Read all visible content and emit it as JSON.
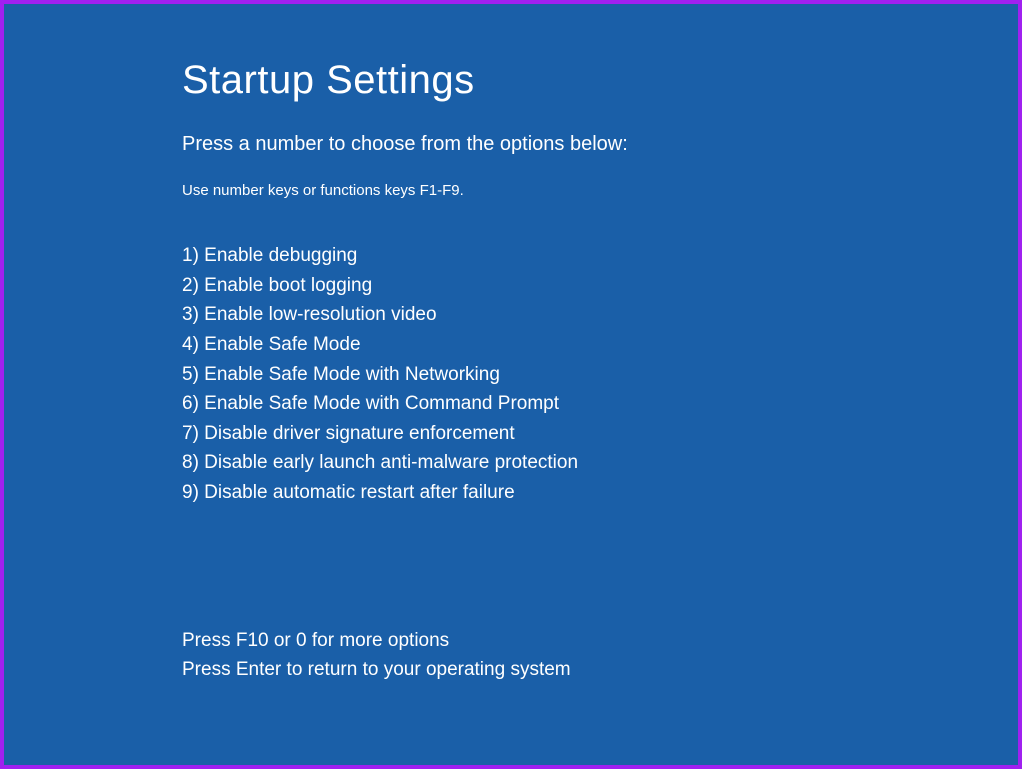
{
  "title": "Startup Settings",
  "instruction": "Press a number to choose from the options below:",
  "hint": "Use number keys or functions keys F1-F9.",
  "options": [
    {
      "label": "1) Enable debugging"
    },
    {
      "label": "2) Enable boot logging"
    },
    {
      "label": "3) Enable low-resolution video"
    },
    {
      "label": "4) Enable Safe Mode"
    },
    {
      "label": "5) Enable Safe Mode with Networking"
    },
    {
      "label": "6) Enable Safe Mode with Command Prompt"
    },
    {
      "label": "7) Disable driver signature enforcement"
    },
    {
      "label": "8) Disable early launch anti-malware protection"
    },
    {
      "label": "9) Disable automatic restart after failure"
    }
  ],
  "footer": {
    "more_options": "Press F10 or 0 for more options",
    "return_os": "Press Enter to return to your operating system"
  }
}
